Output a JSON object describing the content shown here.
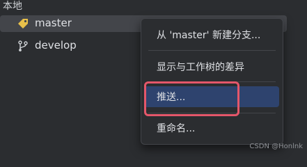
{
  "panel": {
    "section_label": "本地",
    "branches": [
      {
        "name": "master",
        "icon": "tag-icon",
        "selected": true
      },
      {
        "name": "develop",
        "icon": "git-branch-icon",
        "selected": false
      }
    ]
  },
  "context_menu": {
    "items": [
      {
        "label": "从 'master' 新建分支...",
        "highlighted": false
      },
      {
        "label": "显示与工作树的差异",
        "highlighted": false
      },
      {
        "label": "推送...",
        "highlighted": true
      },
      {
        "label": "重命名...",
        "highlighted": false
      }
    ]
  },
  "annotation": {
    "color": "#e4576a"
  },
  "colors": {
    "highlight": "#2e436e",
    "tag_icon": "#e8c04a",
    "background": "#2b2d30"
  },
  "watermark": "CSDN @Honlnk"
}
